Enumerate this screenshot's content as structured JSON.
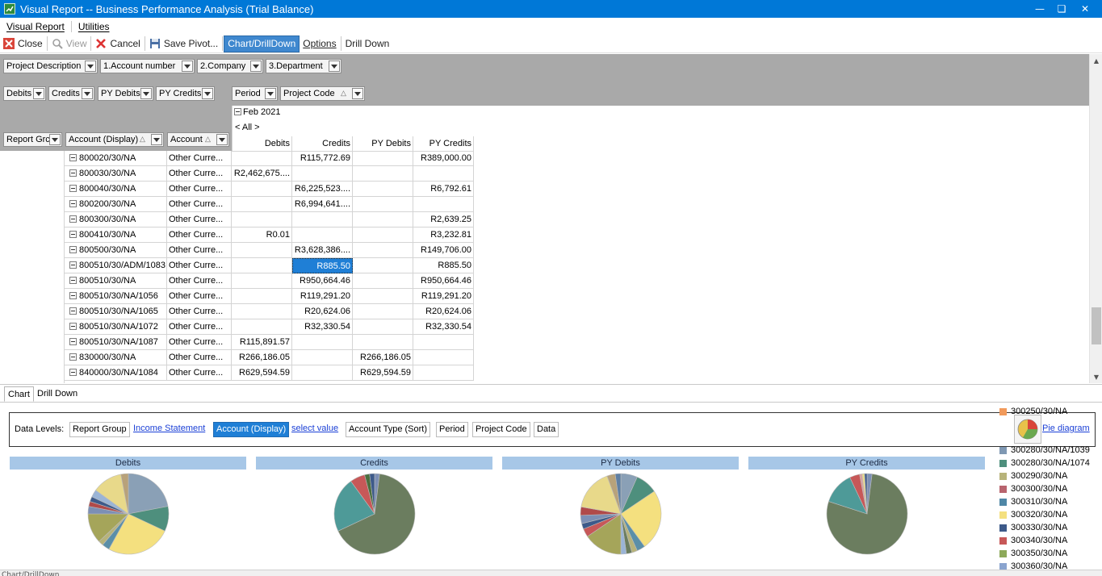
{
  "window": {
    "title": "Visual Report -- Business Performance Analysis (Trial Balance)",
    "controls": [
      "minimize",
      "restore",
      "close"
    ]
  },
  "menu": {
    "items": [
      "Visual Report",
      "Utilities"
    ]
  },
  "toolbar": {
    "close": "Close",
    "view": "View",
    "cancel": "Cancel",
    "save_pivot": "Save Pivot...",
    "chart_drilldown": "Chart/DrillDown",
    "options": "Options",
    "drill_down": "Drill Down"
  },
  "pivot": {
    "filter_fields": [
      "Project Description",
      "1.Account number",
      "2.Company",
      "3.Department"
    ],
    "data_fields": [
      "Debits",
      "Credits",
      "PY Debits",
      "PY Credits"
    ],
    "column_fields": [
      "Period",
      "Project Code"
    ],
    "row_fields": [
      "Report Grc",
      "Account (Display)",
      "Account"
    ],
    "period_header": "Feb 2021",
    "project_header": "< All >",
    "value_headers": [
      "Debits",
      "Credits",
      "PY Debits",
      "PY Credits"
    ],
    "rows": [
      {
        "account": "800020/30/NA",
        "type": "Other Curre...",
        "debits": "",
        "credits": "R115,772.69",
        "py_debits": "",
        "py_credits": "R389,000.00"
      },
      {
        "account": "800030/30/NA",
        "type": "Other Curre...",
        "debits": "R2,462,675....",
        "credits": "",
        "py_debits": "",
        "py_credits": ""
      },
      {
        "account": "800040/30/NA",
        "type": "Other Curre...",
        "debits": "",
        "credits": "R6,225,523....",
        "py_debits": "",
        "py_credits": "R6,792.61"
      },
      {
        "account": "800200/30/NA",
        "type": "Other Curre...",
        "debits": "",
        "credits": "R6,994,641....",
        "py_debits": "",
        "py_credits": ""
      },
      {
        "account": "800300/30/NA",
        "type": "Other Curre...",
        "debits": "",
        "credits": "",
        "py_debits": "",
        "py_credits": "R2,639.25"
      },
      {
        "account": "800410/30/NA",
        "type": "Other Curre...",
        "debits": "R0.01",
        "credits": "",
        "py_debits": "",
        "py_credits": "R3,232.81"
      },
      {
        "account": "800500/30/NA",
        "type": "Other Curre...",
        "debits": "",
        "credits": "R3,628,386....",
        "py_debits": "",
        "py_credits": "R149,706.00"
      },
      {
        "account": "800510/30/ADM/1083",
        "type": "Other Curre...",
        "debits": "",
        "credits": "R885.50",
        "py_debits": "",
        "py_credits": "R885.50",
        "selected": "credits"
      },
      {
        "account": "800510/30/NA",
        "type": "Other Curre...",
        "debits": "",
        "credits": "R950,664.46",
        "py_debits": "",
        "py_credits": "R950,664.46"
      },
      {
        "account": "800510/30/NA/1056",
        "type": "Other Curre...",
        "debits": "",
        "credits": "R119,291.20",
        "py_debits": "",
        "py_credits": "R119,291.20"
      },
      {
        "account": "800510/30/NA/1065",
        "type": "Other Curre...",
        "debits": "",
        "credits": "R20,624.06",
        "py_debits": "",
        "py_credits": "R20,624.06"
      },
      {
        "account": "800510/30/NA/1072",
        "type": "Other Curre...",
        "debits": "",
        "credits": "R32,330.54",
        "py_debits": "",
        "py_credits": "R32,330.54"
      },
      {
        "account": "800510/30/NA/1087",
        "type": "Other Curre...",
        "debits": "R115,891.57",
        "credits": "",
        "py_debits": "",
        "py_credits": ""
      },
      {
        "account": "830000/30/NA",
        "type": "Other Curre...",
        "debits": "R266,186.05",
        "credits": "",
        "py_debits": "R266,186.05",
        "py_credits": ""
      },
      {
        "account": "840000/30/NA/1084",
        "type": "Other Curre...",
        "debits": "R629,594.59",
        "credits": "",
        "py_debits": "R629,594.59",
        "py_credits": ""
      }
    ]
  },
  "subtabs": [
    "Chart",
    "Drill Down"
  ],
  "data_levels": {
    "label": "Data Levels:",
    "report_group": "Report Group",
    "income_statement": "Income Statement",
    "account_display": "Account (Display)",
    "select_value": "select value",
    "account_type": "Account Type (Sort)",
    "period": "Period",
    "project_code": "Project Code",
    "data": "Data",
    "pie_diagram": "Pie diagram"
  },
  "charts": [
    {
      "title": "Debits",
      "slices": [
        {
          "value": 22,
          "color": "#8aa0b6"
        },
        {
          "value": 10,
          "color": "#4e8f7d"
        },
        {
          "value": 26,
          "color": "#f4e07f"
        },
        {
          "value": 3,
          "color": "#5b8fa8"
        },
        {
          "value": 2,
          "color": "#b7b37a"
        },
        {
          "value": 12,
          "color": "#a5a55a"
        },
        {
          "value": 3,
          "color": "#7c8fb5"
        },
        {
          "value": 2,
          "color": "#b04a4a"
        },
        {
          "value": 2,
          "color": "#3d5a8a"
        },
        {
          "value": 3,
          "color": "#9ab4d6"
        },
        {
          "value": 12,
          "color": "#e8d98a"
        },
        {
          "value": 3,
          "color": "#b8a27a"
        }
      ]
    },
    {
      "title": "Credits",
      "slices": [
        {
          "value": 2,
          "color": "#7c8fb5"
        },
        {
          "value": 66,
          "color": "#6b7d5f"
        },
        {
          "value": 22,
          "color": "#4e9a98"
        },
        {
          "value": 6,
          "color": "#c75858"
        },
        {
          "value": 2,
          "color": "#4b6f3f"
        },
        {
          "value": 2,
          "color": "#3d5a8a"
        }
      ]
    },
    {
      "title": "PY Debits",
      "slices": [
        {
          "value": 6,
          "color": "#8aa0b6"
        },
        {
          "value": 8,
          "color": "#4e8f7d"
        },
        {
          "value": 22,
          "color": "#f4e07f"
        },
        {
          "value": 3,
          "color": "#5b8fa8"
        },
        {
          "value": 2,
          "color": "#b7b37a"
        },
        {
          "value": 2,
          "color": "#6b7d5f"
        },
        {
          "value": 2,
          "color": "#9ab4d6"
        },
        {
          "value": 14,
          "color": "#a5a55a"
        },
        {
          "value": 3,
          "color": "#c75858"
        },
        {
          "value": 2,
          "color": "#3d5a8a"
        },
        {
          "value": 3,
          "color": "#7c8fb5"
        },
        {
          "value": 3,
          "color": "#b04a4a"
        },
        {
          "value": 15,
          "color": "#e8d98a"
        },
        {
          "value": 3,
          "color": "#b8a27a"
        },
        {
          "value": 2,
          "color": "#5f7fa3"
        }
      ]
    },
    {
      "title": "PY Credits",
      "slices": [
        {
          "value": 2,
          "color": "#7c8fb5"
        },
        {
          "value": 78,
          "color": "#6b7d5f"
        },
        {
          "value": 13,
          "color": "#4e9a98"
        },
        {
          "value": 4,
          "color": "#c75858"
        },
        {
          "value": 1,
          "color": "#d9a0a0"
        },
        {
          "value": 1,
          "color": "#e8d98a"
        },
        {
          "value": 1,
          "color": "#3d5a8a"
        }
      ]
    }
  ],
  "legend": [
    {
      "label": "300250/30/NA",
      "color": "#f19a5b"
    },
    {
      "label": "300280/30/NA/1039",
      "color": "#7f98b3"
    },
    {
      "label": "300280/30/NA/1074",
      "color": "#4e8f7d"
    },
    {
      "label": "300290/30/NA",
      "color": "#b7b37a"
    },
    {
      "label": "300300/30/NA",
      "color": "#b8646e"
    },
    {
      "label": "300310/30/NA",
      "color": "#4f87a6"
    },
    {
      "label": "300320/30/NA",
      "color": "#f4e07f"
    },
    {
      "label": "300330/30/NA",
      "color": "#3d5a8a"
    },
    {
      "label": "300340/30/NA",
      "color": "#c75858"
    },
    {
      "label": "300350/30/NA",
      "color": "#8da95a"
    },
    {
      "label": "300360/30/NA",
      "color": "#8aa4cf"
    }
  ],
  "statusbar": {
    "text": "Chart/DrillDown"
  }
}
